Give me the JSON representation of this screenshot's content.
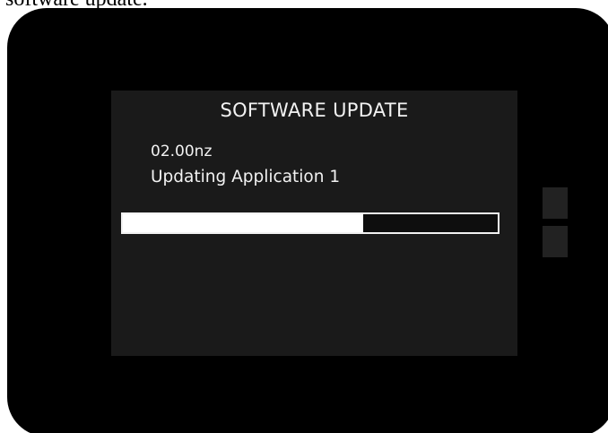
{
  "caption": {
    "text": "software update."
  },
  "screen": {
    "title": "SOFTWARE UPDATE",
    "version": "02.00nz",
    "status": "Updating Application 1",
    "progress_percent": 64
  },
  "side_buttons": [
    {
      "name": "side-button-upper"
    },
    {
      "name": "side-button-lower"
    }
  ]
}
